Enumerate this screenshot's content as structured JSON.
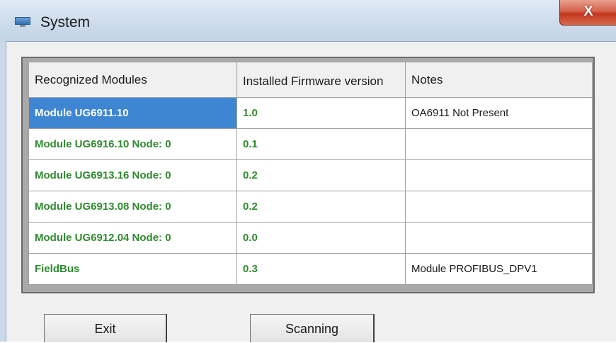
{
  "window": {
    "title": "System",
    "close_glyph": "X",
    "icon": "system-monitor-icon"
  },
  "table": {
    "columns": [
      "Recognized Modules",
      "Installed Firmware version",
      "Notes"
    ],
    "rows": [
      {
        "module": "Module UG6911.10",
        "version": "1.0",
        "notes": "OA6911 Not Present",
        "selected": true
      },
      {
        "module": "Module UG6916.10 Node: 0",
        "version": "0.1",
        "notes": ""
      },
      {
        "module": "Module UG6913.16 Node: 0",
        "version": "0.2",
        "notes": ""
      },
      {
        "module": "Module UG6913.08 Node: 0",
        "version": "0.2",
        "notes": ""
      },
      {
        "module": "Module UG6912.04 Node: 0",
        "version": "0.0",
        "notes": ""
      },
      {
        "module": "FieldBus",
        "version": "0.3",
        "notes": "Module PROFIBUS_DPV1"
      }
    ]
  },
  "buttons": {
    "exit_label": "Exit",
    "scan_label": "Scanning"
  },
  "colors": {
    "module_text": "#2f8a2f",
    "selection": "#3f86d2",
    "close_button": "#c3371e"
  }
}
